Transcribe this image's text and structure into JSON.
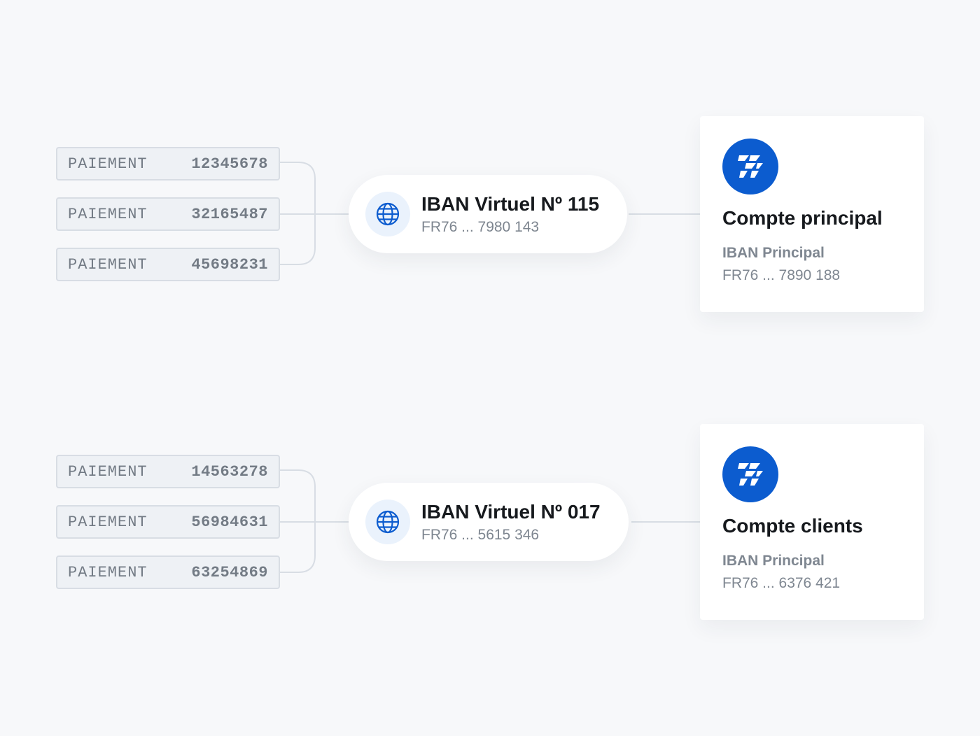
{
  "groups": [
    {
      "payments": [
        {
          "label": "PAIEMENT",
          "number": "12345678"
        },
        {
          "label": "PAIEMENT",
          "number": "32165487"
        },
        {
          "label": "PAIEMENT",
          "number": "45698231"
        }
      ],
      "virtual_iban": {
        "title": "IBAN Virtuel Nº 115",
        "iban": "FR76 ... 7980 143"
      },
      "account": {
        "title": "Compte principal",
        "label": "IBAN Principal",
        "iban": "FR76 ... 7890 188"
      }
    },
    {
      "payments": [
        {
          "label": "PAIEMENT",
          "number": "14563278"
        },
        {
          "label": "PAIEMENT",
          "number": "56984631"
        },
        {
          "label": "PAIEMENT",
          "number": "63254869"
        }
      ],
      "virtual_iban": {
        "title": "IBAN Virtuel Nº 017",
        "iban": "FR76 ... 5615 346"
      },
      "account": {
        "title": "Compte clients",
        "label": "IBAN Principal",
        "iban": "FR76 ... 6376 421"
      }
    }
  ],
  "colors": {
    "background": "#f7f8fa",
    "brand": "#0c5ccf",
    "globe_bg": "#eaf2fc",
    "connector": "#d8dde4",
    "payment_bg": "#eef1f5"
  },
  "icons": {
    "virtual_iban": "globe-icon",
    "account": "bank-logo-icon"
  }
}
